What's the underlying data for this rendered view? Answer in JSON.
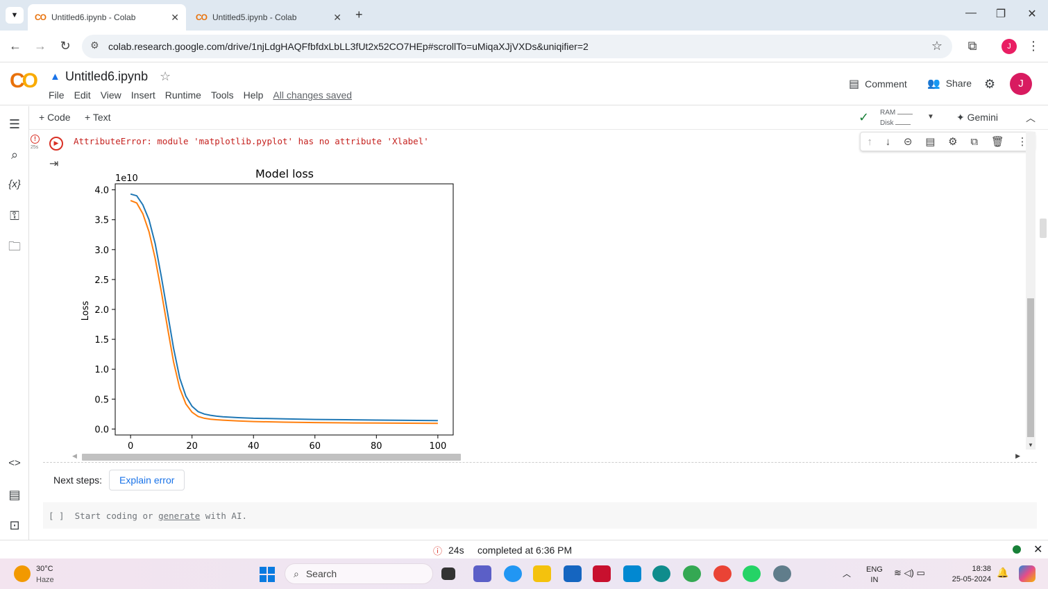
{
  "browser": {
    "tabs": [
      {
        "title": "Untitled6.ipynb - Colab",
        "icon": "colab-logo",
        "active": true
      },
      {
        "title": "Untitled5.ipynb - Colab",
        "icon": "colab-logo",
        "active": false
      }
    ],
    "new_tab": "+",
    "url": "colab.research.google.com/drive/1njLdgHAQFfbfdxLbLL3fUt2x52CO7HEp#scrollTo=uMiqaXJjVXDs&uniqifier=2",
    "profile_initial": "J"
  },
  "colab": {
    "logo": "CO",
    "notebook_title": "Untitled6.ipynb",
    "menu": [
      "File",
      "Edit",
      "View",
      "Insert",
      "Runtime",
      "Tools",
      "Help"
    ],
    "save_status": "All changes saved",
    "comment_label": "Comment",
    "share_label": "Share",
    "avatar_initial": "J",
    "toolbar": {
      "add_code": "+ Code",
      "add_text": "+ Text",
      "ram_label": "RAM",
      "disk_label": "Disk",
      "gemini_label": "Gemini"
    }
  },
  "cell": {
    "exec_time": "25s",
    "error_text": "AttributeError: module 'matplotlib.pyplot' has no attribute 'Xlabel'",
    "next_steps_label": "Next steps:",
    "explain_button": "Explain error"
  },
  "new_cell": {
    "bracket": "[ ]",
    "prefix": "Start coding or ",
    "link": "generate",
    "suffix": " with AI."
  },
  "status": {
    "elapsed": "24s",
    "completed": "completed at 6:36 PM"
  },
  "taskbar": {
    "weather_temp": "30°C",
    "weather_desc": "Haze",
    "search_label": "Search",
    "lang": "ENG",
    "region": "IN",
    "time": "18:38",
    "date": "25-05-2024"
  },
  "colors": {
    "accent": "#1a73e8",
    "error": "#c5221f",
    "series1": "#1f77b4",
    "series2": "#ff7f0e"
  },
  "chart_data": {
    "type": "line",
    "title": "Model loss",
    "ylabel": "Loss",
    "xlabel": "",
    "y_offset_label": "1e10",
    "xlim": [
      -5,
      105
    ],
    "ylim": [
      -0.1,
      4.1
    ],
    "xticks": [
      0,
      20,
      40,
      60,
      80,
      100
    ],
    "yticks": [
      0.0,
      0.5,
      1.0,
      1.5,
      2.0,
      2.5,
      3.0,
      3.5,
      4.0
    ],
    "grid": false,
    "series": [
      {
        "color": "#1f77b4",
        "x": [
          0,
          2,
          4,
          6,
          8,
          10,
          12,
          14,
          16,
          18,
          20,
          22,
          24,
          26,
          28,
          30,
          35,
          40,
          50,
          60,
          70,
          80,
          90,
          100
        ],
        "y": [
          3.93,
          3.9,
          3.75,
          3.5,
          3.1,
          2.55,
          1.95,
          1.35,
          0.85,
          0.55,
          0.38,
          0.29,
          0.25,
          0.23,
          0.215,
          0.205,
          0.19,
          0.18,
          0.17,
          0.16,
          0.155,
          0.15,
          0.145,
          0.14
        ]
      },
      {
        "color": "#ff7f0e",
        "x": [
          0,
          2,
          4,
          6,
          8,
          10,
          12,
          14,
          16,
          18,
          20,
          22,
          24,
          26,
          28,
          30,
          35,
          40,
          50,
          60,
          70,
          80,
          90,
          100
        ],
        "y": [
          3.82,
          3.78,
          3.6,
          3.3,
          2.85,
          2.3,
          1.7,
          1.12,
          0.68,
          0.42,
          0.28,
          0.21,
          0.18,
          0.165,
          0.155,
          0.148,
          0.135,
          0.125,
          0.115,
          0.108,
          0.103,
          0.1,
          0.097,
          0.095
        ]
      }
    ]
  }
}
